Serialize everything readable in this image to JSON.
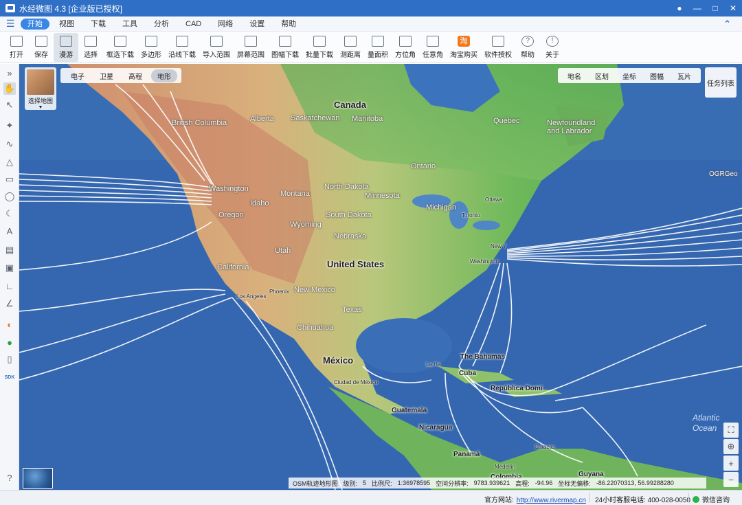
{
  "window": {
    "title": "水经微图 4.3 [企业版已授权]"
  },
  "menubar": {
    "items": [
      "开始",
      "视图",
      "下载",
      "工具",
      "分析",
      "CAD",
      "网络",
      "设置",
      "帮助"
    ],
    "active": "开始"
  },
  "toolbar": {
    "tools": [
      {
        "label": "打开",
        "icon": "folder-icon"
      },
      {
        "label": "保存",
        "icon": "save-icon"
      },
      {
        "label": "漫游",
        "icon": "hand-icon"
      },
      {
        "label": "选择",
        "icon": "cursor-icon"
      },
      {
        "label": "框选下载",
        "icon": "box-download-icon"
      },
      {
        "label": "多边形",
        "icon": "polygon-icon"
      },
      {
        "label": "沿线下载",
        "icon": "line-download-icon"
      },
      {
        "label": "导入范围",
        "icon": "import-range-icon"
      },
      {
        "label": "屏幕范围",
        "icon": "screen-range-icon"
      },
      {
        "label": "图幅下载",
        "icon": "sheet-download-icon"
      },
      {
        "label": "批量下载",
        "icon": "batch-download-icon"
      },
      {
        "label": "测距离",
        "icon": "ruler-icon"
      },
      {
        "label": "量面积",
        "icon": "area-icon"
      },
      {
        "label": "方位角",
        "icon": "azimuth-icon"
      },
      {
        "label": "任意角",
        "icon": "angle-icon"
      },
      {
        "label": "淘宝购买",
        "icon": "taobao-icon"
      },
      {
        "label": "软件授权",
        "icon": "lock-icon"
      },
      {
        "label": "帮助",
        "icon": "help-icon"
      },
      {
        "label": "关于",
        "icon": "info-icon"
      }
    ]
  },
  "map": {
    "select_label": "选择地图",
    "type_tabs": [
      "电子",
      "卫星",
      "高程",
      "地形"
    ],
    "active_type": "地形",
    "layer_tabs": [
      "地名",
      "区划",
      "坐标",
      "图幅",
      "瓦片"
    ],
    "task_list": "任务列表",
    "labels": {
      "canada": "Canada",
      "united_states": "United States",
      "mexico": "México",
      "british_columbia": "British Columbia",
      "alberta": "Alberta",
      "saskatchewan": "Saskatchewan",
      "manitoba": "Manitoba",
      "quebec": "Québec",
      "newfoundland": "Newfoundland and Labrador",
      "ontario": "Ontario",
      "washington": "Washington",
      "montana": "Montana",
      "north_dakota": "North Dakota",
      "minnesota": "Minnesota",
      "idaho": "Idaho",
      "oregon": "Oregon",
      "wyoming": "Wyoming",
      "south_dakota": "South Dakota",
      "nebraska": "Nebraska",
      "michigan": "Michigan",
      "ottawa": "Ottawa",
      "toronto": "Toronto",
      "new_york": "New Y",
      "washington_dc": "Washington",
      "utah": "Utah",
      "california": "California",
      "los_angeles": "Los Angeles",
      "phoenix": "Phoenix",
      "new_mexico": "New Mexico",
      "texas": "Texas",
      "chihuahua": "Chihuahua",
      "ciudad_mexico": "Ciudad de México",
      "bahamas": "The Bahamas",
      "cuba": "Cuba",
      "la_habana": "La Ha",
      "dominicana": "República Domi",
      "guatemala": "Guatemala",
      "nicaragua": "Nicaragua",
      "panama": "Panamá",
      "caracas": "Caracas",
      "medellin": "Medellín",
      "colombia": "Colombia",
      "guyana": "Guyana",
      "atlantic": "Atlantic Ocean",
      "watermark": "OGRGeo"
    }
  },
  "map_status": {
    "source": "OSM轨迹地形图",
    "level_label": "级别:",
    "level": "5",
    "scale_label": "比例尺:",
    "scale": "1:36978595",
    "resolution_label": "空间分辨率:",
    "resolution": "9783.939621",
    "elevation_label": "高程:",
    "elevation": "-94.96",
    "coord_label": "坐标无偏移:",
    "coord": "-86.22070313, 56.99288280"
  },
  "statusbar": {
    "site_label": "官方网站:",
    "site_url": "http://www.rivermap.cn",
    "phone": "24小时客服电话: 400-028-0050",
    "wechat": "微信咨询"
  }
}
